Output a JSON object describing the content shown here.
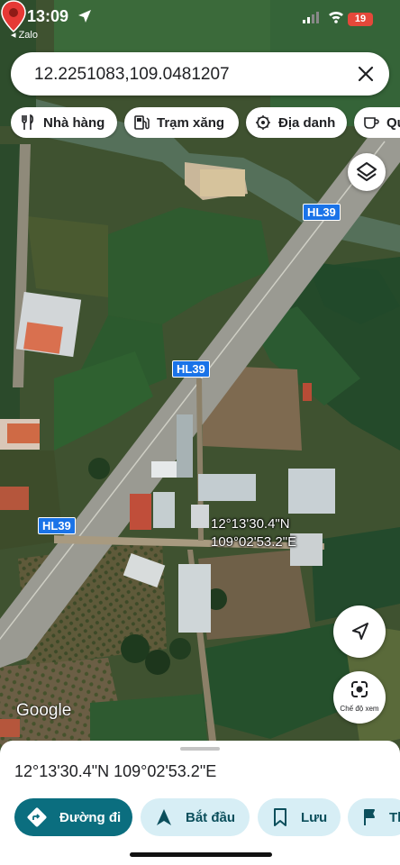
{
  "status_bar": {
    "time": "13:09",
    "back_app": "◂ Zalo",
    "battery": "19"
  },
  "search": {
    "value": "12.2251083,109.0481207"
  },
  "chips": [
    {
      "label": "Nhà hàng",
      "icon": "restaurant-icon"
    },
    {
      "label": "Trạm xăng",
      "icon": "gas-station-icon"
    },
    {
      "label": "Địa danh",
      "icon": "landmark-icon"
    },
    {
      "label": "Qu",
      "icon": "cafe-icon"
    }
  ],
  "map": {
    "road_labels": [
      "HL39",
      "HL39",
      "HL39"
    ],
    "pin_label_lat": "12°13'30.4\"N",
    "pin_label_lng": "109°02'53.2\"E",
    "attribution": "Google",
    "lens_label": "Chế độ xem"
  },
  "sheet": {
    "coordinates": "12°13'30.4\"N 109°02'53.2\"E",
    "actions": [
      {
        "label": "Đường đi",
        "icon": "directions-icon"
      },
      {
        "label": "Bắt đầu",
        "icon": "navigation-arrow-icon"
      },
      {
        "label": "Lưu",
        "icon": "bookmark-icon"
      },
      {
        "label": "Th",
        "icon": "flag-icon"
      }
    ]
  },
  "colors": {
    "accent": "#0b6e7f",
    "chip_secondary": "#d7eef5",
    "pin": "#e53935",
    "road_label": "#1a73e8"
  }
}
